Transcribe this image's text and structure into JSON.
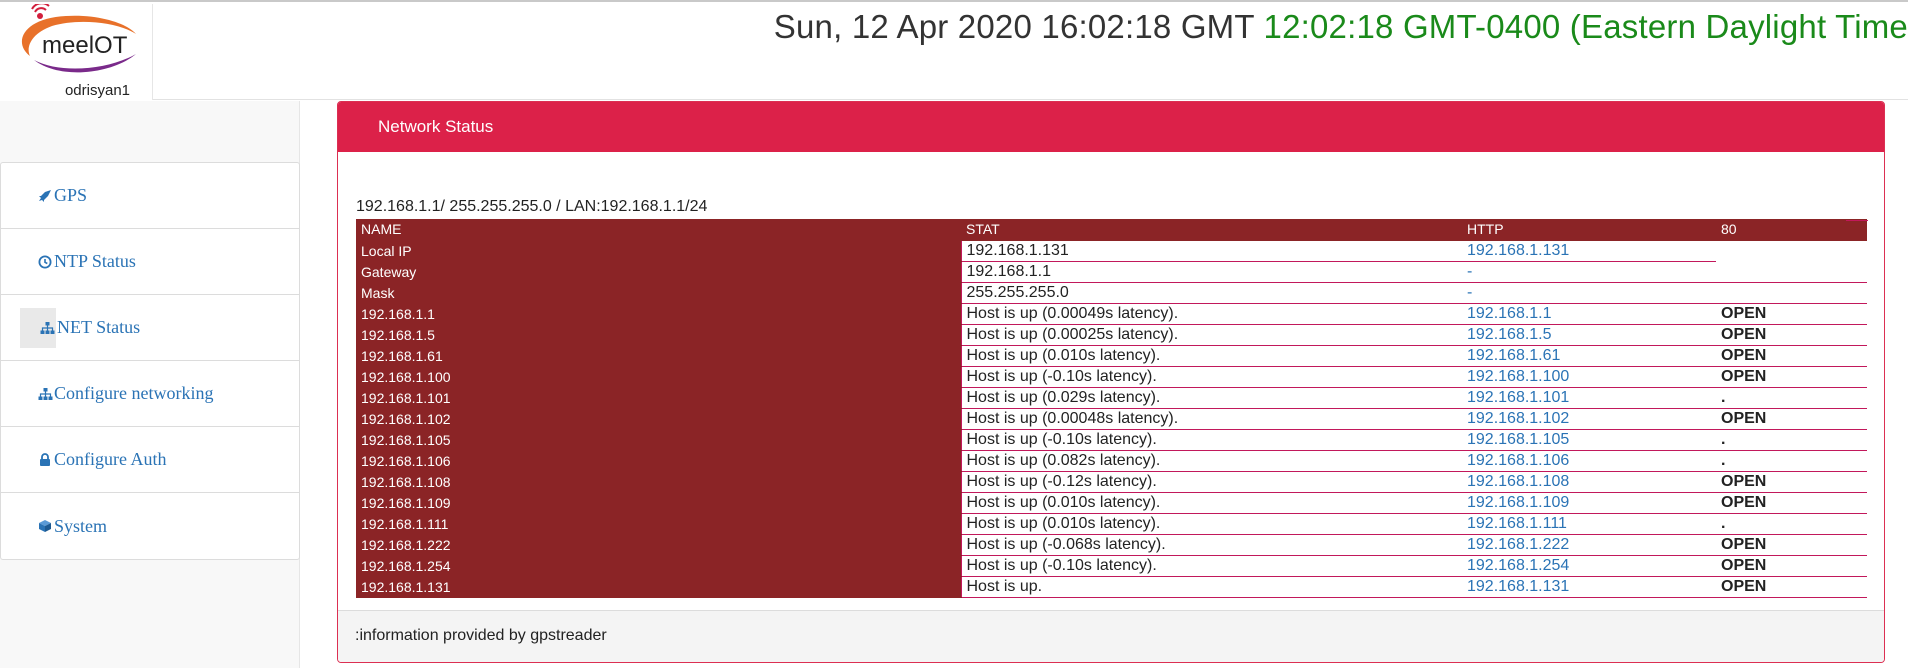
{
  "header": {
    "logo_text": "meelOT",
    "username": "odrisyan1",
    "utc_time": "Sun, 12 Apr 2020 16:02:18 GMT",
    "local_time": "12:02:18 GMT-0400 (Eastern Daylight Time"
  },
  "colors": {
    "panel_header": "#dc2149",
    "table_name_column": "#8b2426",
    "link": "#2a73b5",
    "local_time": "#1a8a1a"
  },
  "sidebar": {
    "items": [
      {
        "label": "GPS",
        "icon": "rocket-icon"
      },
      {
        "label": "NTP Status",
        "icon": "clock-icon"
      },
      {
        "label": "NET Status",
        "icon": "sitemap-icon",
        "active": true
      },
      {
        "label": "Configure networking",
        "icon": "sitemap-icon"
      },
      {
        "label": "Configure Auth",
        "icon": "lock-icon"
      },
      {
        "label": "System",
        "icon": "cube-icon"
      }
    ]
  },
  "panel": {
    "title": "Network Status",
    "lan_info": "192.168.1.1/ 255.255.255.0 / LAN:192.168.1.1/24",
    "footer": ":information provided by gpstreader",
    "table": {
      "headers": [
        "NAME",
        "STAT",
        "HTTP",
        "80"
      ],
      "rows": [
        [
          "Local IP",
          "192.168.1.131",
          "192.168.1.131",
          ""
        ],
        [
          "Gateway",
          "192.168.1.1",
          "-",
          ""
        ],
        [
          "Mask",
          "255.255.255.0",
          "-",
          ""
        ],
        [
          "192.168.1.1",
          "Host is up (0.00049s latency).",
          "192.168.1.1",
          "OPEN"
        ],
        [
          "192.168.1.5",
          "Host is up (0.00025s latency).",
          "192.168.1.5",
          "OPEN"
        ],
        [
          "192.168.1.61",
          "Host is up (0.010s latency).",
          "192.168.1.61",
          "OPEN"
        ],
        [
          "192.168.1.100",
          "Host is up (-0.10s latency).",
          "192.168.1.100",
          "OPEN"
        ],
        [
          "192.168.1.101",
          "Host is up (0.029s latency).",
          "192.168.1.101",
          "."
        ],
        [
          "192.168.1.102",
          "Host is up (0.00048s latency).",
          "192.168.1.102",
          "OPEN"
        ],
        [
          "192.168.1.105",
          "Host is up (-0.10s latency).",
          "192.168.1.105",
          "."
        ],
        [
          "192.168.1.106",
          "Host is up (0.082s latency).",
          "192.168.1.106",
          "."
        ],
        [
          "192.168.1.108",
          "Host is up (-0.12s latency).",
          "192.168.1.108",
          "OPEN"
        ],
        [
          "192.168.1.109",
          "Host is up (0.010s latency).",
          "192.168.1.109",
          "OPEN"
        ],
        [
          "192.168.1.111",
          "Host is up (0.010s latency).",
          "192.168.1.111",
          "."
        ],
        [
          "192.168.1.222",
          "Host is up (-0.068s latency).",
          "192.168.1.222",
          "OPEN"
        ],
        [
          "192.168.1.254",
          "Host is up (-0.10s latency).",
          "192.168.1.254",
          "OPEN"
        ],
        [
          "192.168.1.131",
          "Host is up.",
          "192.168.1.131",
          "OPEN"
        ]
      ]
    }
  }
}
